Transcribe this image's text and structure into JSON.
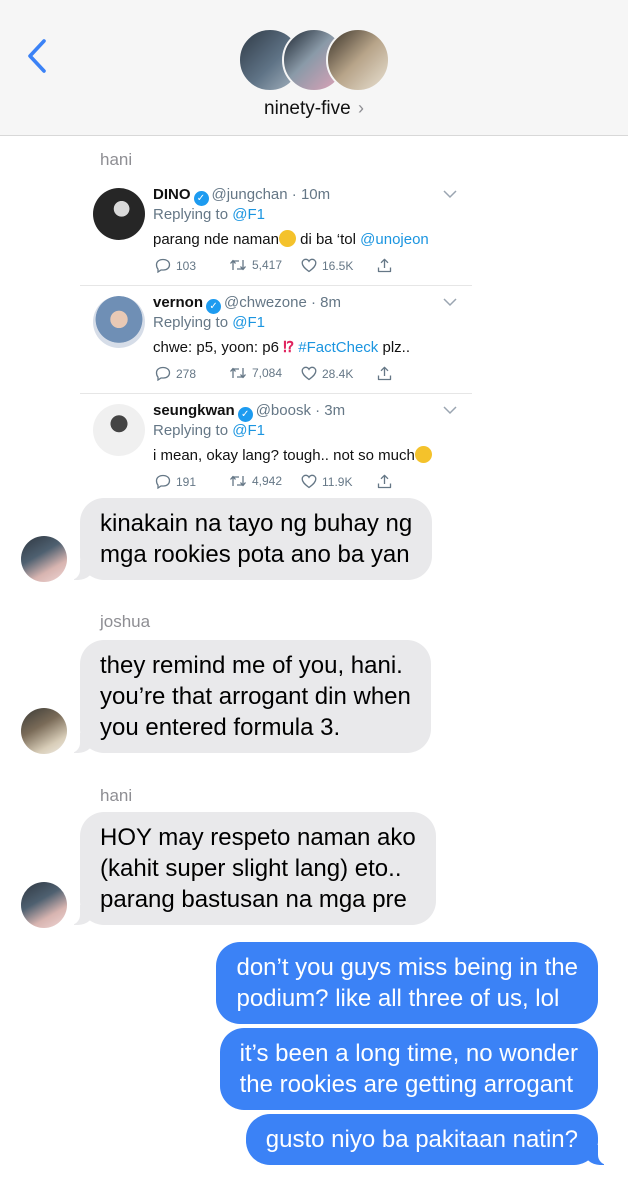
{
  "header": {
    "group_name": "ninety-five",
    "chevron": "›",
    "back_icon": "chevron-left-icon",
    "accent_color": "#3b82f6"
  },
  "messages": {
    "sender_1": "hani",
    "tweets": [
      {
        "name": "DINO",
        "handle": "@jungchan",
        "time": "10m",
        "replying_label": "Replying to",
        "replying_to": "@F1",
        "text_before": "parang nde naman",
        "text_after": " di ba ‘tol ",
        "mention": "@unojeon",
        "replies": "103",
        "retweets": "5,417",
        "likes": "16.5K"
      },
      {
        "name": "vernon",
        "handle": "@chwezone",
        "time": "8m",
        "replying_label": "Replying to",
        "replying_to": "@F1",
        "text_before": "chwe: p5, yoon: p6 ",
        "exclaim": "⁉",
        "hashtag": "#FactCheck",
        "text_after": " plz..",
        "replies": "278",
        "retweets": "7,084",
        "likes": "28.4K"
      },
      {
        "name": "seungkwan",
        "handle": "@boosk",
        "time": "3m",
        "replying_label": "Replying to",
        "replying_to": "@F1",
        "text_before": "i mean, okay lang? tough.. not so much",
        "replies": "191",
        "retweets": "4,942",
        "likes": "11.9K"
      }
    ],
    "bubble_1": [
      "kinakain na tayo ng buhay ng",
      "mga rookies pota ano ba yan"
    ],
    "sender_2": "joshua",
    "bubble_2": [
      "they remind me of you, hani.",
      "you’re that arrogant din when",
      "you entered formula 3."
    ],
    "sender_3": "hani",
    "bubble_3": [
      "HOY may respeto naman ako",
      "(kahit super slight lang) eto..",
      "parang bastusan na mga pre"
    ],
    "out_1": [
      "don’t you guys miss being in the",
      "podium? like all three of us, lol"
    ],
    "out_2": [
      "it’s been a long time, no wonder",
      "the rookies are getting arrogant"
    ],
    "out_3": "gusto niyo ba pakitaan natin?"
  }
}
